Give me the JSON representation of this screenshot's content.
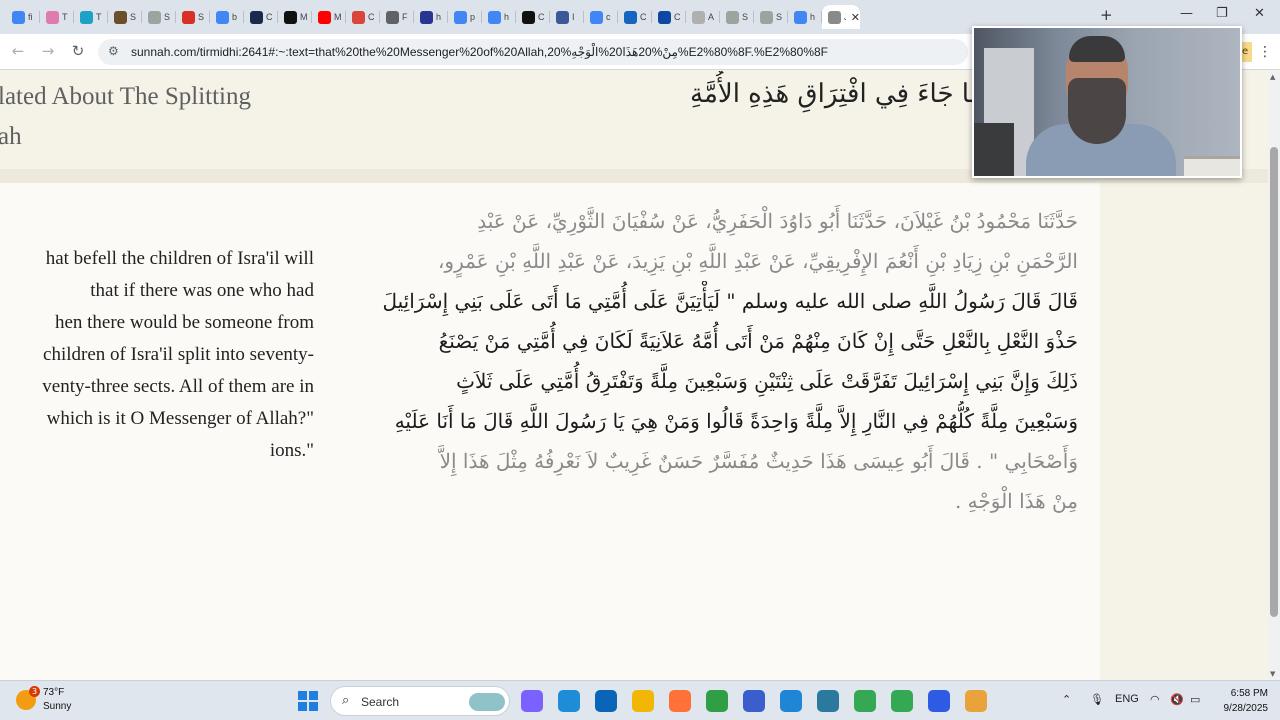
{
  "browser": {
    "tabs": [
      {
        "abbr": "fi",
        "color": "#4285f4"
      },
      {
        "abbr": "T",
        "color": "#e07bb0"
      },
      {
        "abbr": "T",
        "color": "#1da1c4"
      },
      {
        "abbr": "S",
        "color": "#6b4f2a"
      },
      {
        "abbr": "S",
        "color": "#9aa5a0"
      },
      {
        "abbr": "S",
        "color": "#d93025"
      },
      {
        "abbr": "b",
        "color": "#4285f4"
      },
      {
        "abbr": "C",
        "color": "#1a2a4a"
      },
      {
        "abbr": "M",
        "color": "#111111"
      },
      {
        "abbr": "M",
        "color": "#ff0000"
      },
      {
        "abbr": "C",
        "color": "#d9463b"
      },
      {
        "abbr": "F",
        "color": "#5f6368"
      },
      {
        "abbr": "h",
        "color": "#283593"
      },
      {
        "abbr": "p",
        "color": "#4285f4"
      },
      {
        "abbr": "h",
        "color": "#4285f4"
      },
      {
        "abbr": "C",
        "color": "#111111"
      },
      {
        "abbr": "I",
        "color": "#3b5998"
      },
      {
        "abbr": "c",
        "color": "#4285f4"
      },
      {
        "abbr": "C",
        "color": "#1565c0"
      },
      {
        "abbr": "C",
        "color": "#0d47a1"
      },
      {
        "abbr": "A",
        "color": "#b0b0b0"
      },
      {
        "abbr": "S",
        "color": "#9aa5a0"
      },
      {
        "abbr": "S",
        "color": "#9aa5a0"
      },
      {
        "abbr": "h",
        "color": "#4285f4"
      },
      {
        "abbr": "J",
        "color": "#8a8a8a",
        "active": true
      }
    ],
    "new_tab": "+",
    "window_controls": {
      "minimize": "—",
      "maximize": "❐",
      "close": "✕"
    },
    "nav": {
      "back": "←",
      "forward": "→",
      "reload": "↻"
    },
    "url": "sunnah.com/tirmidhi:2641#:~:text=that%20the%20Messenger%20of%20Allah,20%مِنْ%20هَذَا20%الْوَجْهِ%E2%80%8F.%E2%80%8F",
    "update_label": "ate",
    "menu": "⋮"
  },
  "page": {
    "chapter_en_lines": [
      "lated About The Splitting",
      "ah"
    ],
    "chapter_ar": "مَا جَاءَ فِي افْتِرَاقِ هَذِهِ الأُمَّةِ",
    "english_lines": [
      "hat befell the children of Isra'il will",
      "that if there was one who had",
      "hen there would be someone from",
      "children of Isra'il split into seventy-",
      "venty-three sects. All of them are in",
      "which is it O Messenger of Allah?\"",
      "ions.\""
    ],
    "arabic_lines": [
      {
        "text": "حَدَّثَنَا مَحْمُودُ بْنُ غَيْلاَنَ، حَدَّثَنَا أَبُو دَاوُدَ الْحَفَرِيُّ، عَنْ سُفْيَانَ الثَّوْرِيِّ، عَنْ عَبْدِ",
        "gray": true
      },
      {
        "text": "الرَّحْمَنِ بْنِ زِيَادِ بْنِ أَنْعُمَ الإِفْرِيقِيِّ، عَنْ عَبْدِ اللَّهِ بْنِ يَزِيدَ، عَنْ عَبْدِ اللَّهِ بْنِ عَمْرٍو،",
        "gray": true
      },
      {
        "text": "قَالَ قَالَ رَسُولُ اللَّهِ صلى الله عليه وسلم \" لَيَأْتِيَنَّ عَلَى أُمَّتِي مَا أَتَى عَلَى بَنِي إِسْرَائِيلَ",
        "gray": false
      },
      {
        "text": "حَذْوَ النَّعْلِ بِالنَّعْلِ حَتَّى إِنْ كَانَ مِنْهُمْ مَنْ أَتَى أُمَّهُ عَلاَنِيَةً لَكَانَ فِي أُمَّتِي مَنْ يَصْنَعُ",
        "gray": false
      },
      {
        "text": "ذَلِكَ وَإِنَّ بَنِي إِسْرَائِيلَ تَفَرَّقَتْ عَلَى ثِنْتَيْنِ وَسَبْعِينَ مِلَّةً وَتَفْتَرِقُ أُمَّتِي عَلَى ثَلاَثٍ",
        "gray": false
      },
      {
        "text": "وَسَبْعِينَ مِلَّةً كُلُّهُمْ فِي النَّارِ إِلاَّ مِلَّةً وَاحِدَةً قَالُوا وَمَنْ هِيَ يَا رَسُولَ اللَّهِ قَالَ مَا أَنَا عَلَيْهِ",
        "gray": false
      },
      {
        "text": "وَأَصْحَابِي \" . قَالَ أَبُو عِيسَى هَذَا حَدِيثٌ مُفَسَّرٌ حَسَنٌ غَرِيبٌ لاَ نَعْرِفُهُ مِثْلَ هَذَا إِلاَّ",
        "gray": true
      },
      {
        "text": "مِنْ هَذَا الْوَجْهِ .",
        "gray": true
      }
    ]
  },
  "taskbar": {
    "weather_temp": "73°F",
    "weather_cond": "Sunny",
    "weather_badge": "3",
    "search_label": "Search",
    "tray_lang": "ENG",
    "time": "6:58 PM",
    "date": "9/28/2025",
    "apps": [
      "copilot",
      "edge",
      "outlook",
      "file-explorer",
      "firefox",
      "chrome",
      "settings",
      "snipping",
      "notepad",
      "chrome-profile",
      "chrome-active",
      "zoom",
      "chrome-dev"
    ]
  },
  "colors": {
    "page_bg": "#f5f2e8",
    "card_bg": "#fbfaf6",
    "accent_icon": "#2aa8b8"
  }
}
